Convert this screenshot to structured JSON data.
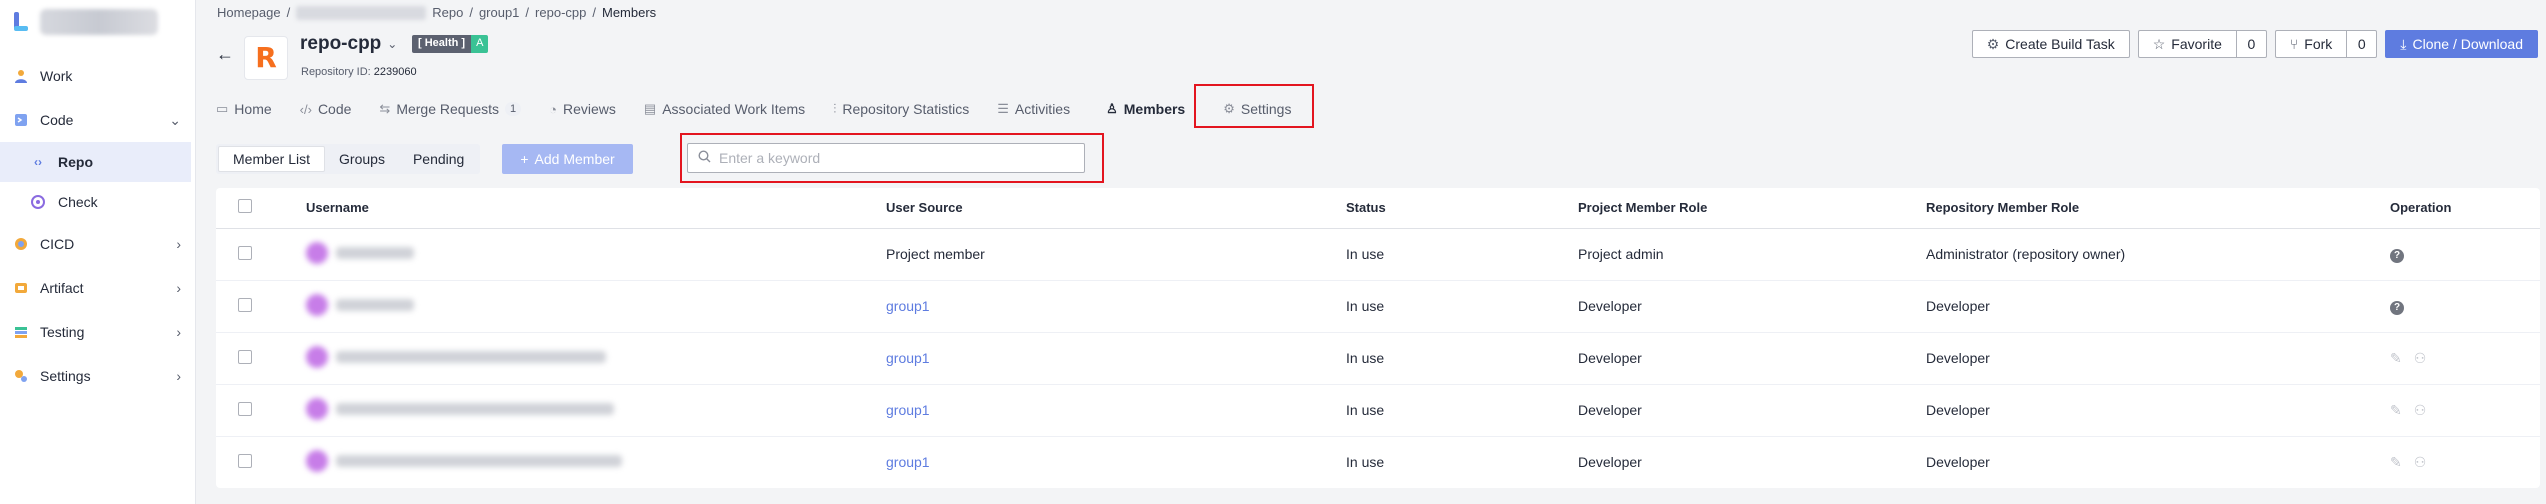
{
  "sidebar": {
    "items": [
      {
        "label": "Work",
        "icon": "work-icon"
      },
      {
        "label": "Code",
        "icon": "code-icon"
      },
      {
        "label": "Repo",
        "icon": "repo-icon"
      },
      {
        "label": "Check",
        "icon": "check-icon"
      },
      {
        "label": "CICD",
        "icon": "cicd-icon"
      },
      {
        "label": "Artifact",
        "icon": "artifact-icon"
      },
      {
        "label": "Testing",
        "icon": "testing-icon"
      },
      {
        "label": "Settings",
        "icon": "settings-icon"
      }
    ]
  },
  "breadcrumb": {
    "home": "Homepage",
    "sep": "/",
    "repo": "Repo",
    "group": "group1",
    "repo_name": "repo-cpp",
    "current": "Members"
  },
  "repo": {
    "name": "repo-cpp",
    "health_label": "[ Health ]",
    "health_grade": "A",
    "id_label": "Repository ID:",
    "id_value": "2239060"
  },
  "actions": {
    "create_build": "Create Build Task",
    "favorite": "Favorite",
    "favorite_count": "0",
    "fork": "Fork",
    "fork_count": "0",
    "clone": "Clone / Download"
  },
  "tabs": [
    {
      "label": "Home"
    },
    {
      "label": "Code"
    },
    {
      "label": "Merge Requests",
      "badge": "1"
    },
    {
      "label": "Reviews"
    },
    {
      "label": "Associated Work Items"
    },
    {
      "label": "Repository Statistics"
    },
    {
      "label": "Activities"
    },
    {
      "label": "Members"
    },
    {
      "label": "Settings"
    }
  ],
  "toolbar": {
    "seg": [
      "Member List",
      "Groups",
      "Pending"
    ],
    "add_member": "Add Member",
    "search_placeholder": "Enter a keyword"
  },
  "table": {
    "headers": [
      "Username",
      "User Source",
      "Status",
      "Project Member Role",
      "Repository Member Role",
      "Operation"
    ],
    "rows": [
      {
        "source": "Project member",
        "source_link": false,
        "status": "In use",
        "project_role": "Project admin",
        "repo_role": "Administrator (repository owner)"
      },
      {
        "source": "group1",
        "source_link": true,
        "status": "In use",
        "project_role": "Developer",
        "repo_role": "Developer"
      },
      {
        "source": "group1",
        "source_link": true,
        "status": "In use",
        "project_role": "Developer",
        "repo_role": "Developer"
      },
      {
        "source": "group1",
        "source_link": true,
        "status": "In use",
        "project_role": "Developer",
        "repo_role": "Developer"
      },
      {
        "source": "group1",
        "source_link": true,
        "status": "In use",
        "project_role": "Developer",
        "repo_role": "Developer"
      }
    ]
  },
  "colors": {
    "primary": "#5e7ce0",
    "highlight": "#e3151f",
    "health": "#3ac295"
  }
}
